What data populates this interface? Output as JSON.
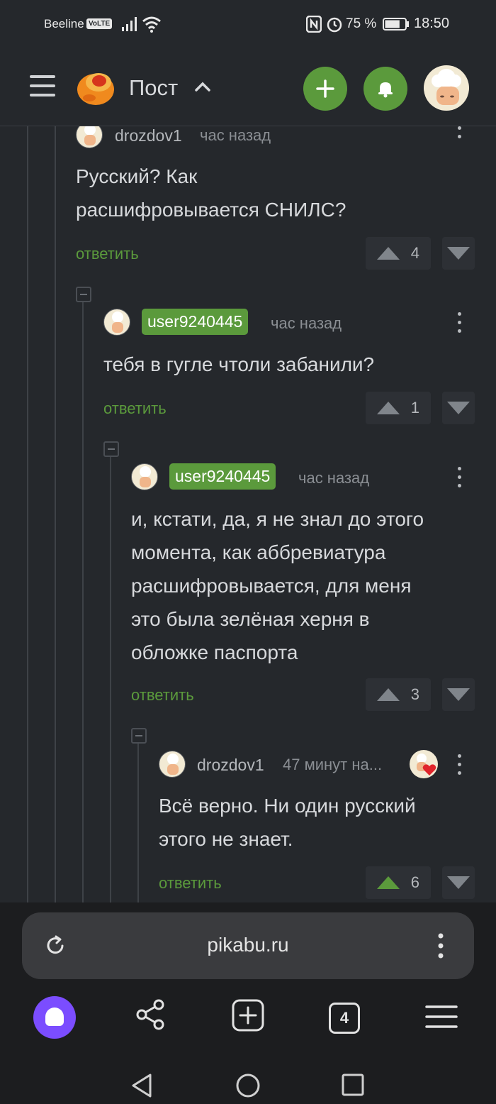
{
  "status_bar": {
    "carrier": "Beeline",
    "volte": "VoLTE",
    "battery_pct": "75 %",
    "battery_level": 0.75,
    "time": "18:50"
  },
  "header": {
    "title": "Пост",
    "accent_color": "#5b9a3c"
  },
  "comments": [
    {
      "author": "drozdov1",
      "author_badge": false,
      "time": "час назад",
      "text_lines": [
        "Русский? Как",
        "расшифровывается СНИЛС?"
      ],
      "reply_label": "ответить",
      "votes": "4"
    },
    {
      "author": "user9240445",
      "author_badge": true,
      "time": "час назад",
      "text_lines": [
        "тебя в гугле чтоли забанили?"
      ],
      "reply_label": "ответить",
      "votes": "1"
    },
    {
      "author": "user9240445",
      "author_badge": true,
      "time": "час назад",
      "text_lines": [
        "и, кстати, да, я не знал до этого",
        "момента, как аббревиатура",
        "расшифровывается, для меня",
        "это была зелёная херня в",
        "обложке паспорта"
      ],
      "reply_label": "ответить",
      "votes": "3"
    },
    {
      "author": "drozdov1",
      "author_badge": false,
      "time": "47 минут на...",
      "text_lines": [
        "Всё верно. Ни один русский",
        "этого не знает."
      ],
      "reply_label": "ответить",
      "votes": "6",
      "upvoted": true
    }
  ],
  "browser": {
    "url": "pikabu.ru",
    "tab_count": "4"
  }
}
